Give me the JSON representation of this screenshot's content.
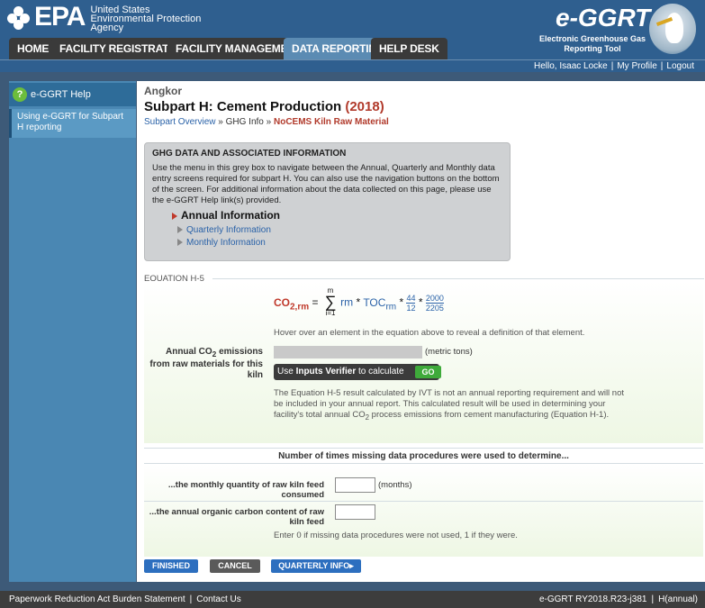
{
  "header": {
    "agency_line1": "United States",
    "agency_line2": "Environmental Protection",
    "agency_line3": "Agency",
    "logo_text": "EPA",
    "brand_title": "e-GGRT",
    "brand_sub1": "Electronic Greenhouse Gas",
    "brand_sub2": "Reporting Tool"
  },
  "nav": {
    "tabs": [
      "HOME",
      "FACILITY REGISTRATION",
      "FACILITY MANAGEMENT",
      "DATA REPORTING",
      "HELP DESK"
    ],
    "active": "DATA REPORTING"
  },
  "utility": {
    "greeting": "Hello, Isaac Locke",
    "profile": "My Profile",
    "logout": "Logout"
  },
  "sidebar": {
    "help_title": "e-GGRT Help",
    "help_link": "Using e-GGRT for Subpart H reporting"
  },
  "main": {
    "facility": "Angkor",
    "title": "Subpart H: Cement Production",
    "year": "(2018)",
    "breadcrumb": {
      "overview": "Subpart Overview",
      "sep": "»",
      "ghg_info": "GHG Info",
      "current": "NoCEMS Kiln Raw Material"
    },
    "greybox": {
      "heading": "GHG DATA AND ASSOCIATED INFORMATION",
      "body": "Use the menu in this grey box to navigate between the Annual, Quarterly and Monthly data entry screens required for subpart H. You can also use the navigation buttons on the bottom of the screen. For additional information about the data collected on this page, please use the e-GGRT Help link(s) provided.",
      "annual": "Annual Information",
      "quarterly": "Quarterly Information",
      "monthly": "Monthly Information"
    },
    "equation": {
      "section_label": "EQUATION H-5",
      "lhs": "CO",
      "lhs_sub": "2,rm",
      "equals": "=",
      "sum_top": "m",
      "sum_bottom": "i=1",
      "rm": "rm",
      "toc": "TOC",
      "toc_sub": "rm",
      "times": "*",
      "f1_num": "44",
      "f1_den": "12",
      "f2_num": "2000",
      "f2_den": "2205",
      "hover_note": "Hover over an element in the equation above to reveal a definition of that element."
    },
    "annual_emissions": {
      "label_line1": "Annual CO",
      "label_sub": "2",
      "label_line1b": " emissions",
      "label_line2": "from raw materials for this kiln",
      "unit": "(metric tons)",
      "verifier_pre": "Use ",
      "verifier_bold": "Inputs Verifier",
      "verifier_post": " to calculate",
      "go": "GO",
      "ivt_note": "The Equation H-5 result calculated by IVT is not an annual reporting requirement and will not be included in your annual report. This calculated result will be used in determining your facility's total annual CO",
      "ivt_note_sub": "2",
      "ivt_note_tail": " process emissions from cement manufacturing (Equation H-1)."
    },
    "missing": {
      "heading": "Number of times missing data procedures were used to determine...",
      "q1": "...the monthly quantity of raw kiln feed consumed",
      "q1_unit": "(months)",
      "q1_value": "",
      "q2": "...the annual organic carbon content of raw kiln feed",
      "q2_value": "",
      "note": "Enter 0 if missing data procedures were not used, 1 if they were."
    },
    "buttons": {
      "finished": "FINISHED",
      "cancel": "CANCEL",
      "quarterly": "QUARTERLY INFO"
    }
  },
  "footer": {
    "paperwork": "Paperwork Reduction Act Burden Statement",
    "contact": "Contact Us",
    "version": "e-GGRT RY2018.R23-j381",
    "mode": "H(annual)"
  },
  "colors": {
    "header_blue": "#2f5f8f",
    "sidebar_blue": "#4a87b3",
    "active_tab": "#5b8bb3",
    "title_red": "#b13a2b",
    "link_blue": "#2a62a8",
    "go_green": "#3eaa3a"
  }
}
